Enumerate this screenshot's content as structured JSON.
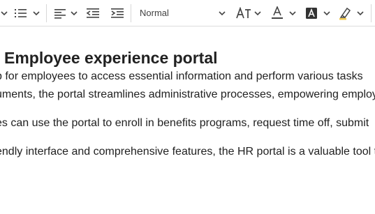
{
  "toolbar": {
    "paragraph_format": "Normal",
    "icons": [
      "bulleted-list-chevron",
      "numbered-list",
      "align-left",
      "outdent",
      "indent",
      "font-size",
      "font-color",
      "background-color",
      "highlight"
    ]
  },
  "document": {
    "heading": "Employee experience portal",
    "paragraphs": [
      "b for employees to access essential information and perform various tasks",
      "uments, the portal streamlines administrative processes, empowering employ",
      "es can use the portal to enroll in benefits programs, request time off, submit",
      "endly interface and comprehensive features, the HR portal is a valuable tool t"
    ]
  }
}
